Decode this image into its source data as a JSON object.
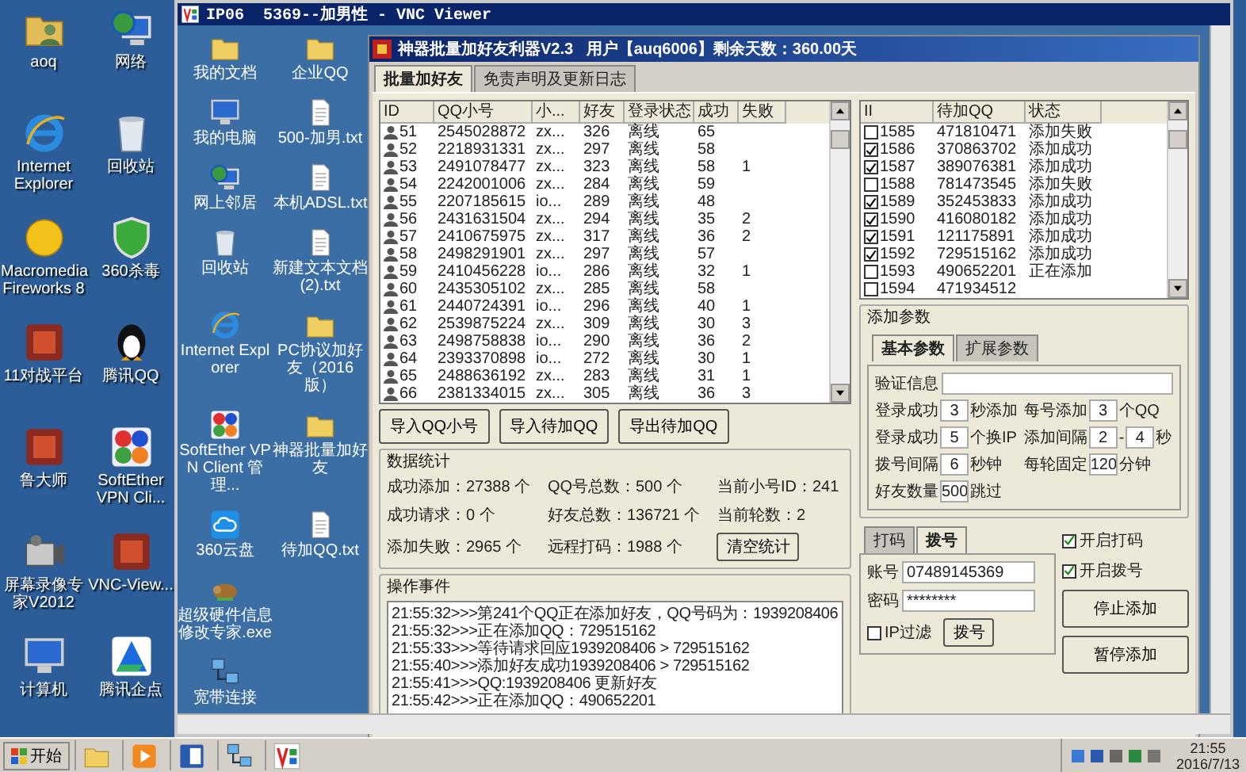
{
  "desktop": {
    "icons": [
      {
        "label": "aoq",
        "kind": "user-folder"
      },
      {
        "label": "Internet Explorer",
        "kind": "browser"
      },
      {
        "label": "Macromedia Fireworks 8",
        "kind": "round-app"
      },
      {
        "label": "11对战平台",
        "kind": "app"
      },
      {
        "label": "鲁大师",
        "kind": "app"
      },
      {
        "label": "屏幕录像专家V2012",
        "kind": "camera"
      },
      {
        "label": "计算机",
        "kind": "computer"
      },
      {
        "label": "网络",
        "kind": "network"
      },
      {
        "label": "回收站",
        "kind": "bin"
      },
      {
        "label": "360杀毒",
        "kind": "shield"
      },
      {
        "label": "腾讯QQ",
        "kind": "penguin"
      },
      {
        "label": "SoftEther VPN Cli...",
        "kind": "dots"
      },
      {
        "label": "VNC-View...",
        "kind": "app"
      },
      {
        "label": "腾讯企点",
        "kind": "triangle"
      }
    ]
  },
  "vnc": {
    "title": "IP06  5369--加男性 - VNC Viewer",
    "remote_icons": [
      {
        "label": "我的文档",
        "kind": "folder"
      },
      {
        "label": "我的电脑",
        "kind": "computer"
      },
      {
        "label": "网上邻居",
        "kind": "network"
      },
      {
        "label": "回收站",
        "kind": "bin"
      },
      {
        "label": "Internet Explorer",
        "kind": "browser"
      },
      {
        "label": "SoftEther VPN Client 管理...",
        "kind": "dots"
      },
      {
        "label": "360云盘",
        "kind": "cloud"
      },
      {
        "label": "超级硬件信息修改专家.exe",
        "kind": "animal"
      },
      {
        "label": "宽带连接",
        "kind": "net-conn"
      },
      {
        "label": "企业QQ",
        "kind": "folder"
      },
      {
        "label": "500-加男.txt",
        "kind": "doc"
      },
      {
        "label": "本机ADSL.txt",
        "kind": "doc"
      },
      {
        "label": "新建文本文档 (2).txt",
        "kind": "doc"
      },
      {
        "label": "PC协议加好友（2016版）",
        "kind": "folder"
      },
      {
        "label": "神器批量加好友",
        "kind": "folder"
      },
      {
        "label": "待加QQ.txt",
        "kind": "doc"
      }
    ]
  },
  "app": {
    "title": "神器批量加好友利器V2.3   用户【auq6006】剩余天数：360.00天",
    "tabs": [
      {
        "label": "批量加好友",
        "selected": true
      },
      {
        "label": "免责声明及更新日志",
        "selected": false
      }
    ],
    "accounts": {
      "columns": [
        "ID",
        "QQ小号",
        "小...",
        "好友",
        "登录状态",
        "成功",
        "失败"
      ],
      "rows": [
        {
          "id": "51",
          "qq": "2545028872",
          "column_3": "zx...",
          "friends": "326",
          "status": "离线",
          "success": "65"
        },
        {
          "id": "52",
          "qq": "2218931331",
          "column_3": "zx...",
          "friends": "297",
          "status": "离线",
          "success": "58"
        },
        {
          "id": "53",
          "qq": "2491078477",
          "column_3": "zx...",
          "friends": "323",
          "status": "离线",
          "success": "58",
          "fail": "1"
        },
        {
          "id": "54",
          "qq": "2242001006",
          "column_3": "zx...",
          "friends": "284",
          "status": "离线",
          "success": "59"
        },
        {
          "id": "55",
          "qq": "2207185615",
          "column_3": "io...",
          "friends": "289",
          "status": "离线",
          "success": "48"
        },
        {
          "id": "56",
          "qq": "2431631504",
          "column_3": "zx...",
          "friends": "294",
          "status": "离线",
          "success": "35",
          "fail": "2"
        },
        {
          "id": "57",
          "qq": "2410675975",
          "column_3": "zx...",
          "friends": "317",
          "status": "离线",
          "success": "36",
          "fail": "2"
        },
        {
          "id": "58",
          "qq": "2498291901",
          "column_3": "zx...",
          "friends": "297",
          "status": "离线",
          "success": "57"
        },
        {
          "id": "59",
          "qq": "2410456228",
          "column_3": "io...",
          "friends": "286",
          "status": "离线",
          "success": "32",
          "fail": "1"
        },
        {
          "id": "60",
          "qq": "2435305102",
          "column_3": "zx...",
          "friends": "285",
          "status": "离线",
          "success": "58"
        },
        {
          "id": "61",
          "qq": "2440724391",
          "column_3": "io...",
          "friends": "296",
          "status": "离线",
          "success": "40",
          "fail": "1"
        },
        {
          "id": "62",
          "qq": "2539875224",
          "column_3": "zx...",
          "friends": "309",
          "status": "离线",
          "success": "30",
          "fail": "3"
        },
        {
          "id": "63",
          "qq": "2498758838",
          "column_3": "io...",
          "friends": "290",
          "status": "离线",
          "success": "36",
          "fail": "2"
        },
        {
          "id": "64",
          "qq": "2393370898",
          "column_3": "io...",
          "friends": "272",
          "status": "离线",
          "success": "30",
          "fail": "1"
        },
        {
          "id": "65",
          "qq": "2488636192",
          "column_3": "zx...",
          "friends": "283",
          "status": "离线",
          "success": "31",
          "fail": "1"
        },
        {
          "id": "66",
          "qq": "2381334015",
          "column_3": "zx...",
          "friends": "305",
          "status": "离线",
          "success": "36",
          "fail": "3"
        }
      ]
    },
    "buttons": [
      "导入QQ小号",
      "导入待加QQ",
      "导出待加QQ"
    ],
    "stats": {
      "title": "数据统计",
      "items": [
        "成功添加：27388 个",
        "QQ号总数：500 个",
        "当前小号ID：241",
        "成功请求：0 个",
        "好友总数：136721 个",
        "当前轮数：2",
        "添加失败：2965 个",
        "远程打码：1988 个"
      ],
      "clear_button": "清空统计"
    },
    "log": {
      "title": "操作事件",
      "lines": [
        "21:55:32>>>第241个QQ正在添加好友，QQ号码为：1939208406",
        "21:55:32>>>正在添加QQ：729515162",
        "21:55:33>>>等待请求回应1939208406 > 729515162",
        "21:55:40>>>添加好友成功1939208406 > 729515162",
        "21:55:41>>>QQ:1939208406 更新好友",
        "21:55:42>>>正在添加QQ：490652201"
      ]
    },
    "queue": {
      "columns": [
        "II",
        "待加QQ",
        "状态"
      ],
      "rows": [
        {
          "checked": false,
          "id": "1585",
          "qq": "471810471",
          "status": "添加失败"
        },
        {
          "checked": true,
          "id": "1586",
          "qq": "370863702",
          "status": "添加成功"
        },
        {
          "checked": true,
          "id": "1587",
          "qq": "389076381",
          "status": "添加成功"
        },
        {
          "checked": false,
          "id": "1588",
          "qq": "781473545",
          "status": "添加失败"
        },
        {
          "checked": true,
          "id": "1589",
          "qq": "352453833",
          "status": "添加成功"
        },
        {
          "checked": true,
          "id": "1590",
          "qq": "416080182",
          "status": "添加成功"
        },
        {
          "checked": true,
          "id": "1591",
          "qq": "121175891",
          "status": "添加成功"
        },
        {
          "checked": true,
          "id": "1592",
          "qq": "729515162",
          "status": "添加成功"
        },
        {
          "checked": false,
          "id": "1593",
          "qq": "490652201",
          "status": "正在添加"
        },
        {
          "checked": false,
          "id": "1594",
          "qq": "471934512"
        }
      ]
    },
    "params": {
      "title": "添加参数",
      "tabs": [
        {
          "label": "基本参数",
          "selected": true
        },
        {
          "label": "扩展参数",
          "selected": false
        }
      ],
      "verify_label": "验证信息",
      "settings": [
        {
          "label": "登录成功",
          "values": [
            "3"
          ],
          "unit": "秒添加"
        },
        {
          "label": "每号添加",
          "values": [
            "3"
          ],
          "unit": "个QQ"
        },
        {
          "label": "登录成功",
          "values": [
            "5"
          ],
          "unit": "个换IP"
        },
        {
          "label": "添加间隔",
          "values": [
            "2",
            "4"
          ],
          "separator": "-",
          "unit": "秒"
        },
        {
          "label": "拨号间隔",
          "values": [
            "6"
          ],
          "unit": "秒钟"
        },
        {
          "label": "每轮固定",
          "values": [
            "120"
          ],
          "unit": "分钟"
        },
        {
          "label": "好友数量",
          "values": [
            "500"
          ],
          "unit": "跳过"
        }
      ]
    },
    "dial": {
      "tabs": [
        {
          "label": "打码",
          "selected": false
        },
        {
          "label": "拨号",
          "selected": true
        }
      ],
      "account_label": "账号",
      "account": "07489145369",
      "password_label": "密码",
      "password": "********",
      "ip_filter": {
        "label": "IP过滤",
        "checked": false
      },
      "dial_button": "拨号"
    },
    "options": [
      {
        "label": "开启打码",
        "checked": true
      },
      {
        "label": "开启拨号",
        "checked": true
      }
    ],
    "actions": [
      "停止添加",
      "暂停添加"
    ]
  },
  "taskbar": {
    "start": "开始",
    "apps": [
      {
        "kind": "folder"
      },
      {
        "kind": "media"
      },
      {
        "kind": "word"
      },
      {
        "kind": "net-conn"
      },
      {
        "kind": "vnc"
      }
    ],
    "time": "21:55",
    "date": "2016/7/13"
  }
}
